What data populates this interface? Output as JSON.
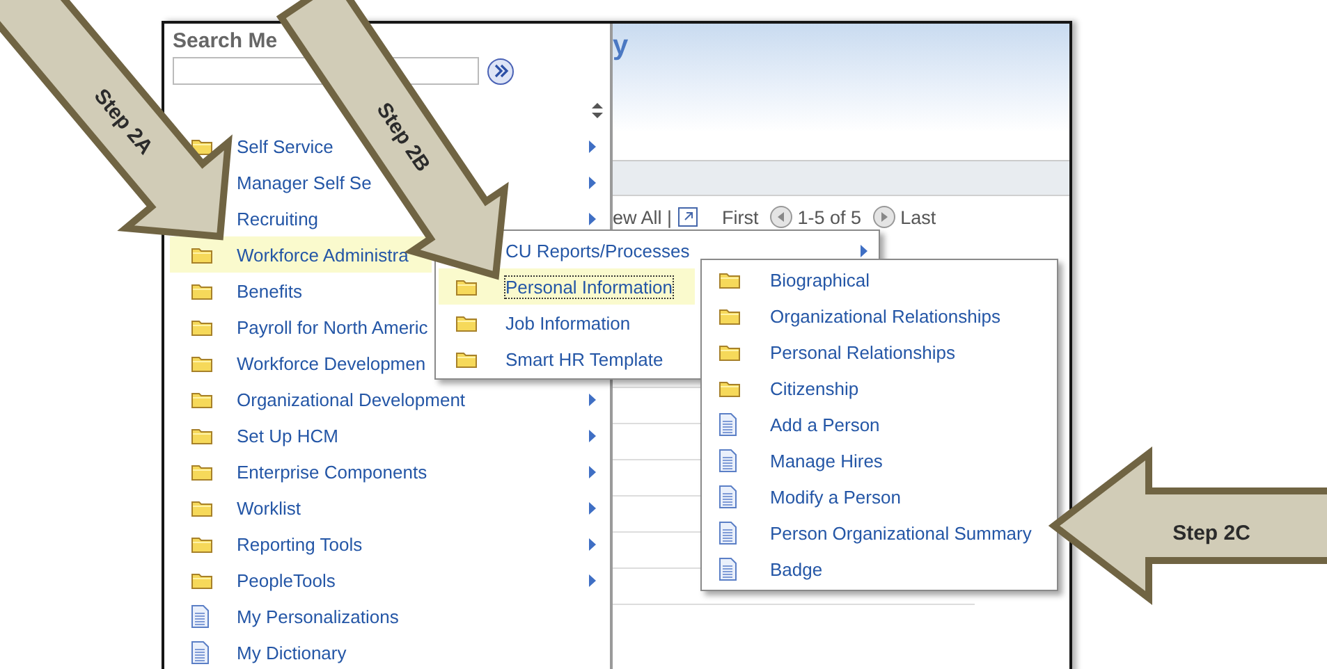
{
  "page": {
    "title_fragment": "y",
    "pager": {
      "view_all": "ew All |",
      "first": "First",
      "range": "1-5 of 5",
      "last": "Last"
    }
  },
  "search_menu": {
    "title": "Search Me",
    "items": [
      {
        "label": "Self Service",
        "kind": "folder",
        "expandable": true,
        "selected": false
      },
      {
        "label": "Manager Self Se",
        "expandable": true,
        "selected": false
      },
      {
        "label": "Recruiting",
        "expandable": true,
        "selected": false
      },
      {
        "label": "Workforce Administra",
        "kind": "folder",
        "expandable": false,
        "selected": true
      },
      {
        "label": "Benefits",
        "kind": "folder",
        "expandable": false,
        "selected": false
      },
      {
        "label": "Payroll for North Americ",
        "kind": "folder",
        "expandable": false,
        "selected": false
      },
      {
        "label": "Workforce Developmen",
        "kind": "folder",
        "expandable": false,
        "selected": false
      },
      {
        "label": "Organizational Development",
        "kind": "folder",
        "expandable": true,
        "selected": false
      },
      {
        "label": "Set Up HCM",
        "kind": "folder",
        "expandable": true,
        "selected": false
      },
      {
        "label": "Enterprise Components",
        "kind": "folder",
        "expandable": true,
        "selected": false
      },
      {
        "label": "Worklist",
        "kind": "folder",
        "expandable": true,
        "selected": false
      },
      {
        "label": "Reporting Tools",
        "kind": "folder",
        "expandable": true,
        "selected": false
      },
      {
        "label": "PeopleTools",
        "kind": "folder",
        "expandable": true,
        "selected": false
      },
      {
        "label": "My Personalizations",
        "kind": "page",
        "expandable": false,
        "selected": false
      },
      {
        "label": "My Dictionary",
        "kind": "page",
        "expandable": false,
        "selected": false
      }
    ]
  },
  "submenus": [
    {
      "items": [
        {
          "label": "CU Reports/Processes",
          "expandable": true,
          "selected": false
        },
        {
          "label": "Personal Information",
          "kind": "folder",
          "expandable": false,
          "selected": true
        },
        {
          "label": "Job Information",
          "kind": "folder",
          "expandable": false,
          "selected": false
        },
        {
          "label": "Smart HR Template",
          "kind": "folder",
          "expandable": false,
          "selected": false
        }
      ]
    },
    {
      "items": [
        {
          "label": "Biographical",
          "kind": "folder",
          "expandable": false,
          "selected": false
        },
        {
          "label": "Organizational Relationships",
          "kind": "folder",
          "expandable": false,
          "selected": false
        },
        {
          "label": "Personal Relationships",
          "kind": "folder",
          "expandable": false,
          "selected": false
        },
        {
          "label": "Citizenship",
          "kind": "folder",
          "expandable": false,
          "selected": false
        },
        {
          "label": "Add a Person",
          "kind": "page",
          "expandable": false,
          "selected": false
        },
        {
          "label": "Manage Hires",
          "kind": "page",
          "expandable": false,
          "selected": false
        },
        {
          "label": "Modify a Person",
          "kind": "page",
          "expandable": false,
          "selected": false
        },
        {
          "label": "Person Organizational Summary",
          "kind": "page",
          "expandable": false,
          "selected": false
        },
        {
          "label": "Badge",
          "kind": "page",
          "expandable": false,
          "selected": false
        }
      ]
    }
  ],
  "annotations": [
    {
      "label": "Step 2A"
    },
    {
      "label": "Step 2B"
    },
    {
      "label": "Step 2C"
    }
  ]
}
